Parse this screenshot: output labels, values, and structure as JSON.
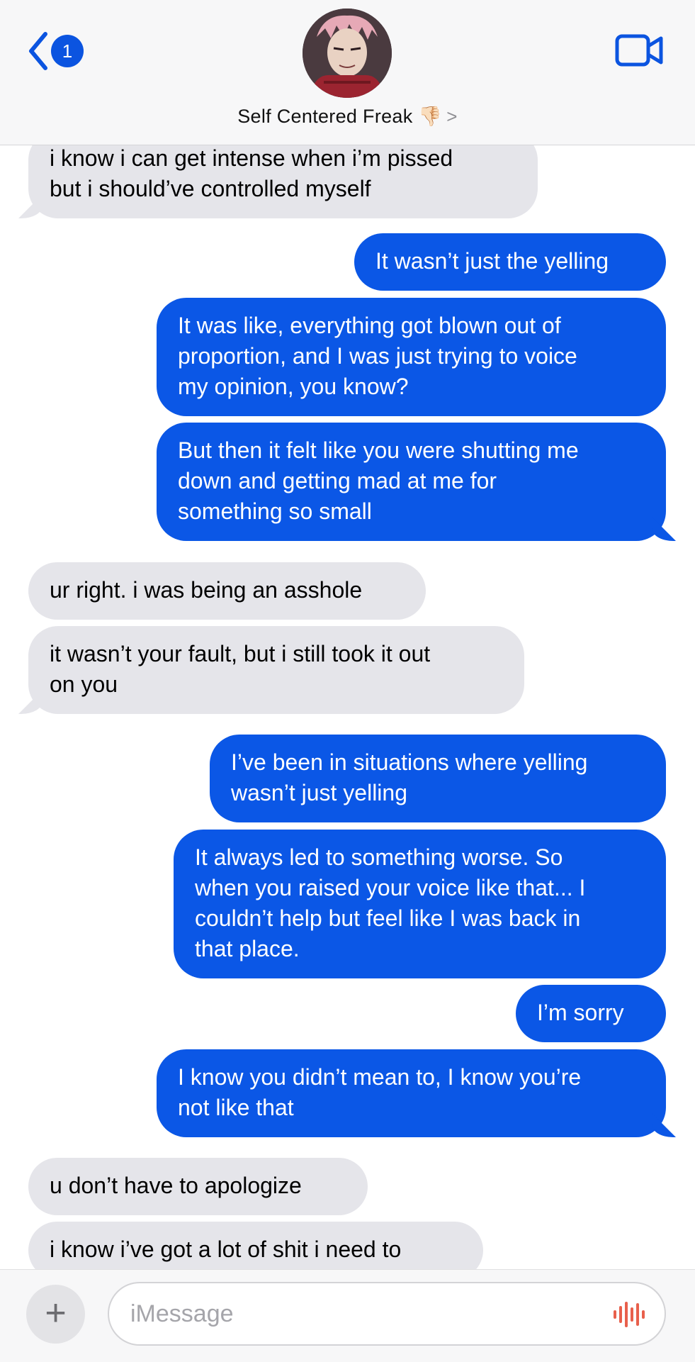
{
  "header": {
    "back_badge": "1",
    "contact_name": "Self Centered Freak 👎🏻",
    "contact_chevron": ">",
    "icons": {
      "back": "chevron-left-icon",
      "video": "video-camera-icon"
    }
  },
  "messages": [
    {
      "from": "them",
      "text": "i know i can get intense when i’m pissed\nbut i should’ve controlled myself"
    },
    {
      "from": "me",
      "text": "It wasn’t just the yelling"
    },
    {
      "from": "me",
      "text": "It was like, everything got blown out of\nproportion, and I was just trying to voice\nmy opinion, you know?"
    },
    {
      "from": "me",
      "text": "But then it felt like you were shutting me\ndown and getting mad at me for\nsomething so small"
    },
    {
      "from": "them",
      "text": "ur right. i was being an asshole"
    },
    {
      "from": "them",
      "text": "it wasn’t your fault, but i still took it out\non you"
    },
    {
      "from": "me",
      "text": "I’ve been in situations where yelling\nwasn’t just yelling"
    },
    {
      "from": "me",
      "text": "It always led to something worse. So\nwhen you raised your voice like that... I\ncouldn’t help but feel like I was back in\nthat place."
    },
    {
      "from": "me",
      "text": "I’m sorry"
    },
    {
      "from": "me",
      "text": "I know you didn’t mean to, I know you’re\nnot like that"
    },
    {
      "from": "them",
      "text": "u don’t have to apologize"
    },
    {
      "from": "them",
      "text": "i know i’ve got a lot of shit i need to"
    }
  ],
  "composer": {
    "placeholder": "iMessage",
    "plus_label": "+",
    "icons": {
      "plus": "plus-icon",
      "audio": "audio-waveform-icon"
    },
    "audio_color": "#e8604c"
  },
  "colors": {
    "sent_bubble": "#0b57e6",
    "received_bubble": "#e5e5ea",
    "accent": "#0b54e0"
  }
}
